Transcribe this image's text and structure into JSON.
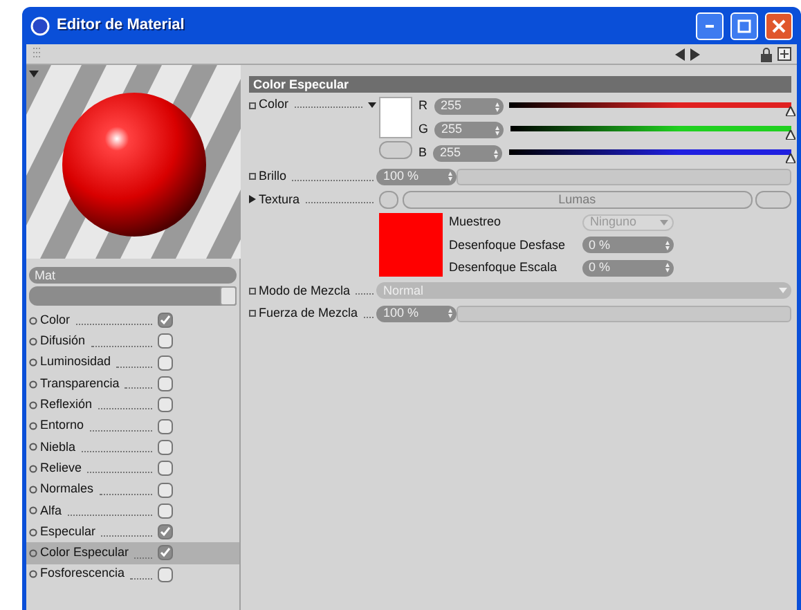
{
  "window": {
    "title": "Editor de Material"
  },
  "material": {
    "name": "Mat"
  },
  "channels": [
    {
      "label": "Color",
      "checked": true,
      "selected": false
    },
    {
      "label": "Difusión",
      "checked": false,
      "selected": false
    },
    {
      "label": "Luminosidad",
      "checked": false,
      "selected": false
    },
    {
      "label": "Transparencia",
      "checked": false,
      "selected": false
    },
    {
      "label": "Reflexión",
      "checked": false,
      "selected": false
    },
    {
      "label": "Entorno",
      "checked": false,
      "selected": false
    },
    {
      "label": "Niebla",
      "checked": false,
      "selected": false
    },
    {
      "label": "Relieve",
      "checked": false,
      "selected": false
    },
    {
      "label": "Normales",
      "checked": false,
      "selected": false
    },
    {
      "label": "Alfa",
      "checked": false,
      "selected": false
    },
    {
      "label": "Especular",
      "checked": true,
      "selected": false
    },
    {
      "label": "Color Especular",
      "checked": true,
      "selected": true
    },
    {
      "label": "Fosforescencia",
      "checked": false,
      "selected": false
    }
  ],
  "section": {
    "title": "Color Especular",
    "color": {
      "label": "Color",
      "components": [
        {
          "letter": "R",
          "value": "255",
          "level": 1,
          "color": "#e02020"
        },
        {
          "letter": "G",
          "value": "255",
          "level": 1,
          "color": "#20d020"
        },
        {
          "letter": "B",
          "value": "255",
          "level": 1,
          "color": "#2020e0"
        }
      ]
    },
    "brightness": {
      "label": "Brillo",
      "value": "100 %"
    },
    "texture": {
      "label": "Textura",
      "button": "Lumas",
      "sampling": {
        "label": "Muestreo",
        "value": "Ninguno",
        "disabled": true
      },
      "blur_offset": {
        "label": "Desenfoque Desfase",
        "value": "0 %"
      },
      "blur_scale": {
        "label": "Desenfoque Escala",
        "value": "0 %"
      }
    },
    "blend_mode": {
      "label": "Modo de Mezcla",
      "value": "Normal"
    },
    "blend_strength": {
      "label": "Fuerza de Mezcla",
      "value": "100 %"
    }
  }
}
